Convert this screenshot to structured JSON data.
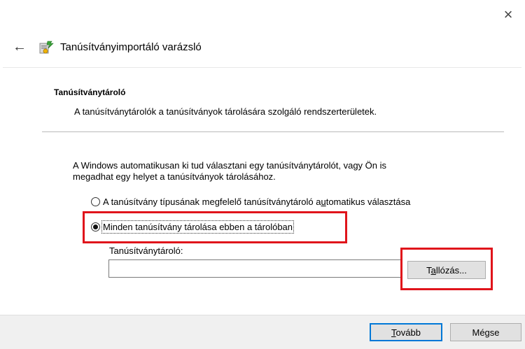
{
  "window": {
    "close_symbol": "×",
    "back_symbol": "←",
    "title": "Tanúsítványimportáló varázsló",
    "icon": "certificate-wizard-icon"
  },
  "section": {
    "heading": "Tanúsítványtároló",
    "description": "A tanúsítványtárolók a tanúsítványok tárolására szolgáló rendszerterületek."
  },
  "info": {
    "line1": "A Windows automatikusan ki tud választani egy tanúsítványtárolót, vagy Ön is",
    "line2": "megadhat egy helyet a tanúsítványok tárolásához."
  },
  "options": {
    "auto": {
      "label_before": "A tanúsítvány típusának megfelelő tanúsítványtároló a",
      "label_underlined": "u",
      "label_after": "tomatikus választása",
      "selected": false
    },
    "all": {
      "label": "Minden tanúsítvány tárolása ebben a tárolóban",
      "selected": true
    }
  },
  "store": {
    "label": "Tanúsítványtároló:",
    "value": ""
  },
  "buttons": {
    "browse": {
      "before": "T",
      "underlined": "a",
      "after": "llózás..."
    },
    "next": {
      "underlined": "T",
      "after": "ovább"
    },
    "cancel": "Mégse"
  },
  "colors": {
    "highlight": "#e0141b",
    "footer_bg": "#f0f0f0",
    "default_button_border": "#0078d7"
  }
}
